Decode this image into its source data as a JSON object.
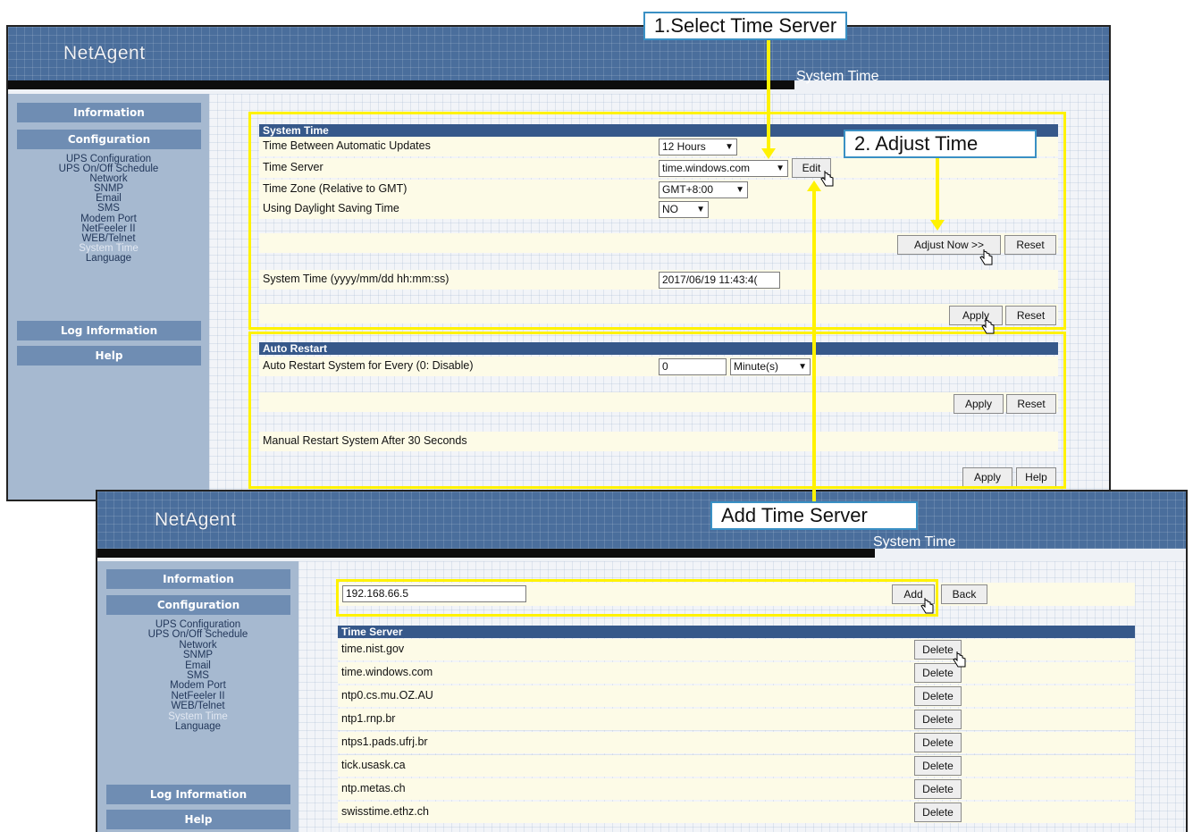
{
  "callouts": {
    "select_time_server": "1.Select Time Server",
    "adjust_time": "2. Adjust Time",
    "add_time_server": "Add Time Server"
  },
  "top_window": {
    "logo": "NetAgent",
    "page_title": "System Time",
    "sidebar": {
      "information": "Information",
      "configuration": "Configuration",
      "links": [
        "UPS Configuration",
        "UPS On/Off Schedule",
        "Network",
        "SNMP",
        "Email",
        "SMS",
        "Modem Port",
        "NetFeeler II",
        "WEB/Telnet",
        "System Time",
        "Language"
      ],
      "log_information": "Log Information",
      "help": "Help"
    },
    "system_time": {
      "header": "System Time",
      "update_label": "Time Between Automatic Updates",
      "update_value": "12 Hours",
      "server_label": "Time Server",
      "server_value": "time.windows.com",
      "edit_label": "Edit",
      "zone_label": "Time Zone (Relative to GMT)",
      "zone_value": "GMT+8:00",
      "dst_label": "Using Daylight Saving Time",
      "dst_value": "NO",
      "adjust_label": "Adjust Now >>",
      "reset_label": "Reset",
      "systime_label": "System Time (yyyy/mm/dd hh:mm:ss)",
      "systime_value": "2017/06/19 11:43:4(",
      "apply_label": "Apply",
      "reset2_label": "Reset"
    },
    "auto_restart": {
      "header": "Auto Restart",
      "every_label": "Auto Restart System for Every (0: Disable)",
      "every_value": "0",
      "unit_value": "Minute(s)",
      "apply_label": "Apply",
      "reset_label": "Reset",
      "manual_label": "Manual Restart System After 30 Seconds",
      "apply2_label": "Apply",
      "help_label": "Help"
    }
  },
  "bottom_window": {
    "logo": "NetAgent",
    "page_title": "System Time",
    "sidebar": {
      "information": "Information",
      "configuration": "Configuration",
      "links": [
        "UPS Configuration",
        "UPS On/Off Schedule",
        "Network",
        "SNMP",
        "Email",
        "SMS",
        "Modem Port",
        "NetFeeler II",
        "WEB/Telnet",
        "System Time",
        "Language"
      ],
      "log_information": "Log Information",
      "help": "Help"
    },
    "add_input_value": "192.168.66.5",
    "add_label": "Add",
    "back_label": "Back",
    "time_server_header": "Time Server",
    "delete_label": "Delete",
    "servers": [
      "time.nist.gov",
      "time.windows.com",
      "ntp0.cs.mu.OZ.AU",
      "ntp1.rnp.br",
      "ntps1.pads.ufrj.br",
      "tick.usask.ca",
      "ntp.metas.ch",
      "swisstime.ethz.ch"
    ]
  }
}
